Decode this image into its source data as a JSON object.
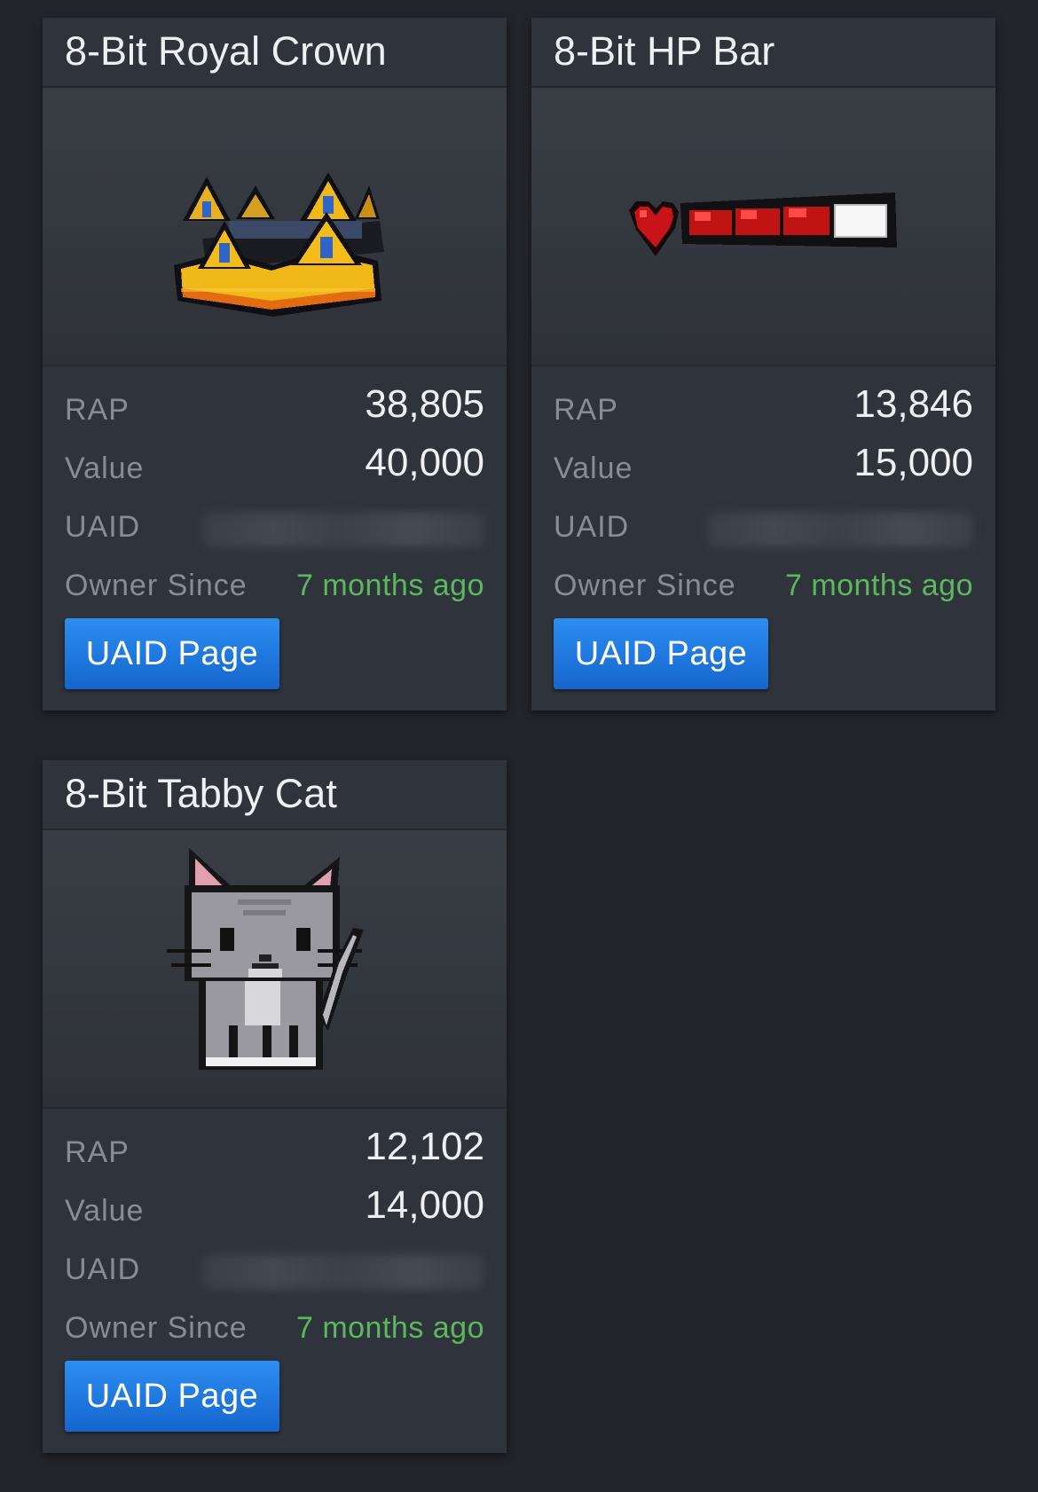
{
  "labels": {
    "rap": "RAP",
    "value": "Value",
    "uaid": "UAID",
    "owner_since": "Owner Since",
    "button": "UAID Page"
  },
  "items": [
    {
      "title": "8-Bit Royal Crown",
      "thumbnail_icon": "pixel-crown-icon",
      "rap": "38,805",
      "value": "40,000",
      "uaid_blurred": true,
      "owner_since": "7 months ago"
    },
    {
      "title": "8-Bit HP Bar",
      "thumbnail_icon": "pixel-hp-bar-icon",
      "rap": "13,846",
      "value": "15,000",
      "uaid_blurred": true,
      "owner_since": "7 months ago"
    },
    {
      "title": "8-Bit Tabby Cat",
      "thumbnail_icon": "pixel-cat-icon",
      "rap": "12,102",
      "value": "14,000",
      "uaid_blurred": true,
      "owner_since": "7 months ago"
    }
  ],
  "colors": {
    "page_bg": "#22252b",
    "card_bg": "#2f333b",
    "owner_since": "#5cb85c",
    "button": "#1a78e0"
  }
}
